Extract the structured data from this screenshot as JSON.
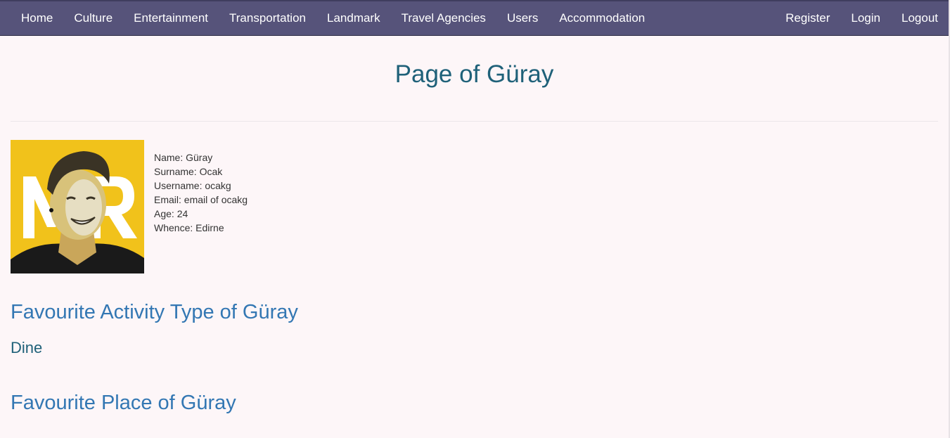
{
  "nav": {
    "left": [
      "Home",
      "Culture",
      "Entertainment",
      "Transportation",
      "Landmark",
      "Travel Agencies",
      "Users",
      "Accommodation"
    ],
    "right": [
      "Register",
      "Login",
      "Logout"
    ]
  },
  "page": {
    "title": "Page of Güray"
  },
  "profile": {
    "name": "Name: Güray",
    "surname": "Surname: Ocak",
    "username": "Username: ocakg",
    "email": "Email: email of ocakg",
    "age": "Age: 24",
    "whence": "Whence: Edirne",
    "avatar_logo_text": "MR"
  },
  "sections": {
    "activity_heading": "Favourite Activity Type of Güray",
    "activity_value": "Dine",
    "place_heading": "Favourite Place of Güray"
  },
  "colors": {
    "navbar": "#56537a",
    "background": "#fdf6f8",
    "title": "#1f6179",
    "heading": "#3377b3",
    "avatar_yellow": "#f1c21b"
  }
}
